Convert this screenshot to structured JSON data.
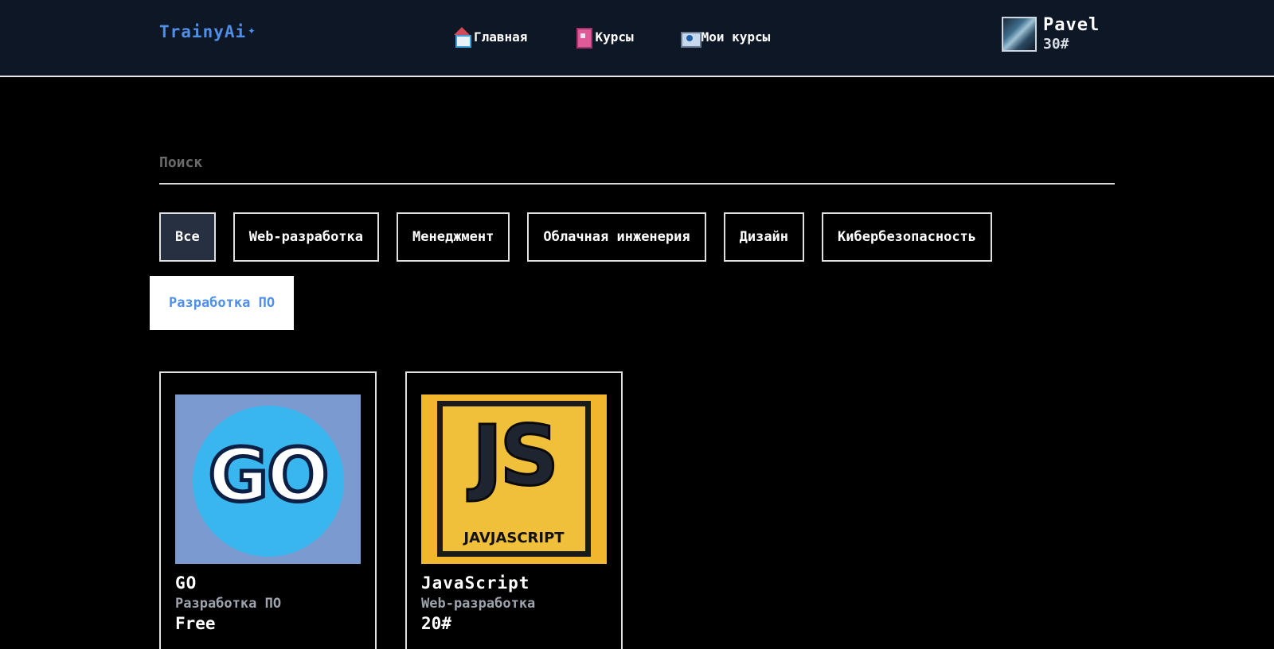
{
  "header": {
    "logo": "TrainyAi",
    "logo_spark": "✦",
    "nav": [
      {
        "label": "Главная",
        "icon": "home-icon"
      },
      {
        "label": "Курсы",
        "icon": "book-icon"
      },
      {
        "label": "Мои курсы",
        "icon": "camera-icon"
      }
    ],
    "user": {
      "name": "Pavel",
      "balance": "30#"
    }
  },
  "search": {
    "placeholder": "Поиск",
    "value": ""
  },
  "filters": [
    {
      "label": "Все"
    },
    {
      "label": "Web-разработка"
    },
    {
      "label": "Менеджмент"
    },
    {
      "label": "Облачная инженерия"
    },
    {
      "label": "Дизайн"
    },
    {
      "label": "Кибербезопасность"
    },
    {
      "label": "Разработка ПО"
    }
  ],
  "courses": [
    {
      "title": "GO",
      "category": "Разработка ПО",
      "price": "Free",
      "image_text": "GO"
    },
    {
      "title": "JavaScript",
      "category": "Web-разработка",
      "price": "20#",
      "image_text": "JS",
      "image_subtext": "JAVJASCRIPT"
    }
  ],
  "colors": {
    "accent": "#4f8fe8",
    "header_bg": "#0e1726",
    "chip_all_bg": "#263040"
  }
}
